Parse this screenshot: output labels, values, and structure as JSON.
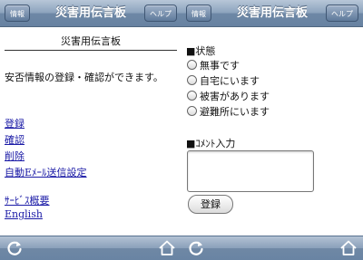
{
  "left": {
    "nav": {
      "info_btn": "情報",
      "title": "災害用伝言板",
      "help_btn": "ヘルプ"
    },
    "page_title": "災害用伝言板",
    "notice": "安否情報の登録・確認ができます。",
    "links": [
      "登録",
      "確認",
      "削除",
      "自動Eﾒｰﾙ送信設定"
    ],
    "links2": [
      "ｻｰﾋﾞｽ概要",
      "English"
    ]
  },
  "right": {
    "nav": {
      "info_btn": "情報",
      "title": "災害用伝言板",
      "help_btn": "ヘルプ"
    },
    "status_label": "■状態",
    "status_options": [
      "無事です",
      "自宅にいます",
      "被害があります",
      "避難所にいます"
    ],
    "comment_label": "■ｺﾒﾝﾄ入力",
    "comment_value": "",
    "submit_label": "登録"
  },
  "toolbar": {
    "refresh_icon": "refresh-icon",
    "home_icon": "home-icon"
  },
  "colors": {
    "nav_bar": "#7b93b0",
    "link": "#1a1aa6"
  }
}
